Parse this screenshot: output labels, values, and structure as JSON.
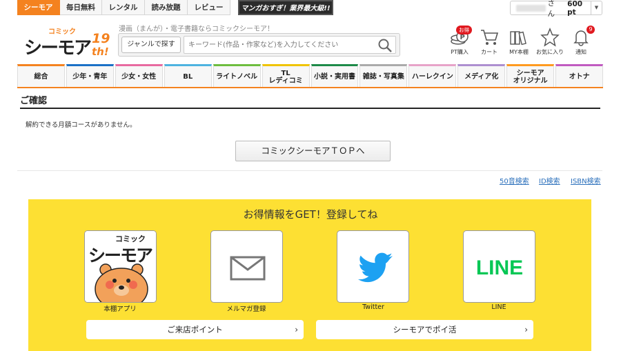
{
  "topnav": {
    "items": [
      "シーモア",
      "毎日無料",
      "レンタル",
      "読み放題",
      "レビュー"
    ]
  },
  "banner": {
    "text": "マンガおすぎ！業界最大級!!"
  },
  "user": {
    "suffix": "さん",
    "points": "600 pt",
    "dropdown": "▼"
  },
  "header": {
    "logo_small": "コミック",
    "logo_main": "シーモア",
    "logo_badge": "19th!",
    "tagline": "漫画（まんが）・電子書籍ならコミックシーモア！",
    "genre_button": "ジャンルで探す",
    "search_placeholder": "キーワード(作品・作家など)を入力してください",
    "icons": [
      {
        "label": "PT購入",
        "icon": "coin-icon"
      },
      {
        "label": "カート",
        "icon": "cart-icon"
      },
      {
        "label": "MY本棚",
        "icon": "bookshelf-icon"
      },
      {
        "label": "お気に入り",
        "icon": "star-icon"
      },
      {
        "label": "通知",
        "icon": "bell-icon"
      }
    ],
    "otoku_badge": "お得",
    "notification_count": "9"
  },
  "categories": [
    {
      "label": "総合",
      "color": "#f4821f"
    },
    {
      "label": "少年・青年",
      "color": "#1a70c6"
    },
    {
      "label": "少女・女性",
      "color": "#e86aa0"
    },
    {
      "label": "BL",
      "color": "#4db3e0"
    },
    {
      "label": "ライトノベル",
      "color": "#6dbd3e"
    },
    {
      "label": "TL\nレディコミ",
      "color": "#f0c400"
    },
    {
      "label": "小説・実用書",
      "color": "#1d8a48"
    },
    {
      "label": "雑誌・写真集",
      "color": "#aaaaaa"
    },
    {
      "label": "ハーレクイン",
      "color": "#e7a3c8"
    },
    {
      "label": "メディア化",
      "color": "#ad8fd0"
    },
    {
      "label": "シーモア\nオリジナル",
      "color": "#ff9a1f"
    },
    {
      "label": "オトナ",
      "color": "#c05ac0"
    }
  ],
  "confirm": {
    "title": "ご確認",
    "message": "解約できる月額コースがありません。",
    "top_button": "コミックシーモアＴＯＰへ"
  },
  "search_links": [
    "50音検索",
    "ID検索",
    "ISBN検索"
  ],
  "register": {
    "title": "お得情報をGET！登録してね",
    "tiles": [
      {
        "label": "本棚アプリ",
        "icon": "cmoa-app-icon"
      },
      {
        "label": "メルマガ登録",
        "icon": "mail-icon"
      },
      {
        "label": "Twitter",
        "icon": "twitter-bird-icon"
      },
      {
        "label": "LINE",
        "icon": "line-logo-icon",
        "logo_text": "LINE"
      }
    ],
    "app_logo_small": "コミック",
    "app_logo_main": "シーモア",
    "buttons": [
      "ご来店ポイント",
      "シーモアでポイ活"
    ],
    "chevron": "›"
  },
  "colors": {
    "accent": "#f4821f",
    "yellow": "#fde033",
    "link": "#2a6fbb",
    "twitter": "#1da1f2",
    "line": "#06c755"
  }
}
